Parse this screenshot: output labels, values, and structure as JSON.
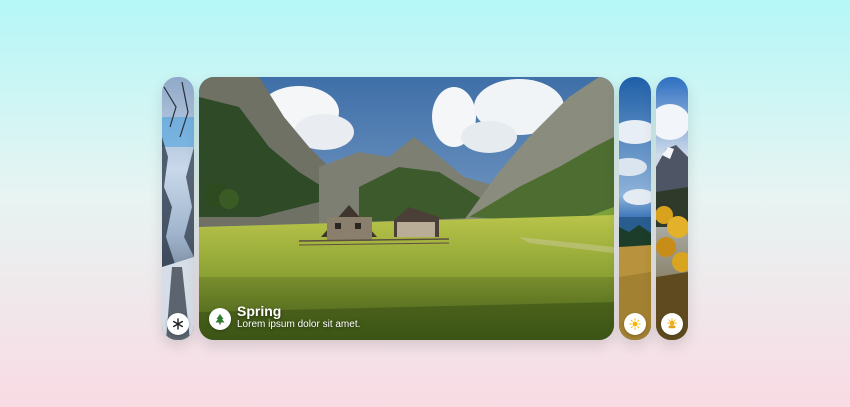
{
  "slider": {
    "cards": [
      {
        "season": "winter",
        "icon": "snowflake-icon",
        "active": false
      },
      {
        "season": "spring",
        "icon": "tree-icon",
        "active": true,
        "title": "Spring",
        "subtitle": "Lorem ipsum dolor sit amet."
      },
      {
        "season": "summer",
        "icon": "sun-icon",
        "active": false
      },
      {
        "season": "autumn",
        "icon": "sun-cloud-icon",
        "active": false
      }
    ]
  },
  "colors": {
    "background_top": "#b5f7f7",
    "background_bottom": "#f9dbe4",
    "badge_bg": "#ffffff",
    "spring_icon": "#2e7d32",
    "summer_icon": "#f4b400",
    "autumn_icon": "#e6a01c",
    "winter_icon": "#222222"
  }
}
